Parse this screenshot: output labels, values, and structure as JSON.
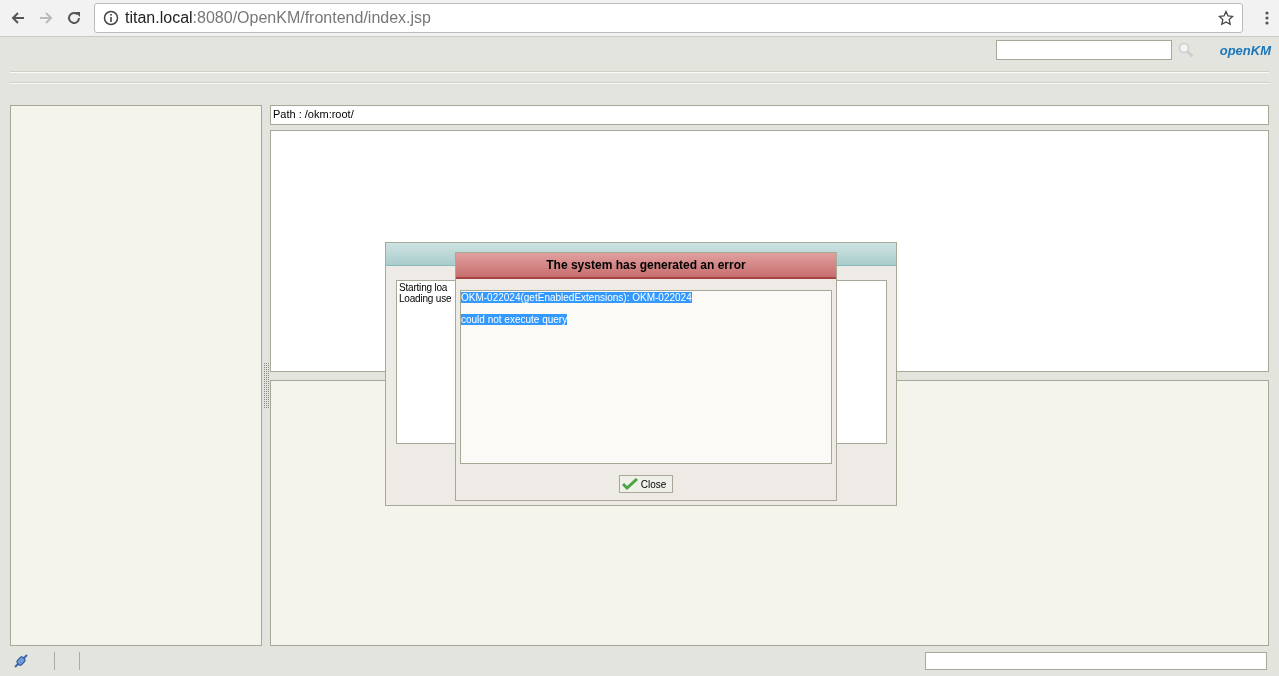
{
  "browser": {
    "url_host": "titan.local",
    "url_path": ":8080/OpenKM/frontend/index.jsp"
  },
  "header": {
    "logo": "openKM"
  },
  "path_bar": "Path : /okm:root/",
  "loading_dialog": {
    "lines": [
      "Starting loa",
      "Loading use"
    ]
  },
  "error_dialog": {
    "title": "The system has generated an error",
    "lines": [
      "OKM-022024(getEnabledExtensions): OKM-022024",
      "could not execute query"
    ],
    "close_button": "Close"
  }
}
